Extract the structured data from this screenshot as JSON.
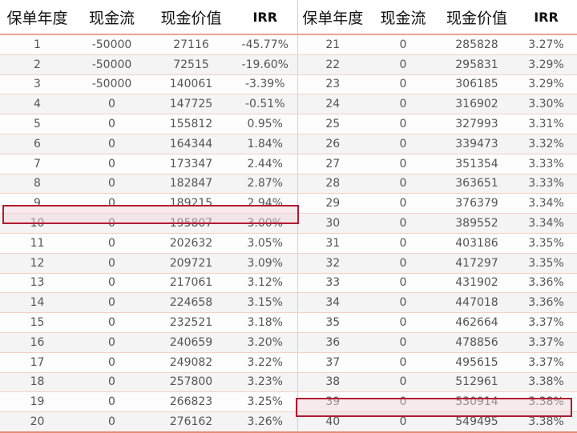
{
  "headers": [
    "保单年度",
    "现金流",
    "现金价值",
    "IRR",
    "保单年度",
    "现金流",
    "现金价值",
    "IRR"
  ],
  "rows": [
    [
      "1",
      "-50000",
      "27116",
      "-45.77%",
      "21",
      "0",
      "285828",
      "3.27%"
    ],
    [
      "2",
      "-50000",
      "72515",
      "-19.60%",
      "22",
      "0",
      "295831",
      "3.29%"
    ],
    [
      "3",
      "-50000",
      "140061",
      "-3.39%",
      "23",
      "0",
      "306185",
      "3.29%"
    ],
    [
      "4",
      "0",
      "147725",
      "-0.51%",
      "24",
      "0",
      "316902",
      "3.30%"
    ],
    [
      "5",
      "0",
      "155812",
      "0.95%",
      "25",
      "0",
      "327993",
      "3.31%"
    ],
    [
      "6",
      "0",
      "164344",
      "1.84%",
      "26",
      "0",
      "339473",
      "3.32%"
    ],
    [
      "7",
      "0",
      "173347",
      "2.44%",
      "27",
      "0",
      "351354",
      "3.33%"
    ],
    [
      "8",
      "0",
      "182847",
      "2.87%",
      "28",
      "0",
      "363651",
      "3.33%"
    ],
    [
      "9",
      "0",
      "189215",
      "2.94%",
      "29",
      "0",
      "376379",
      "3.34%"
    ],
    [
      "10",
      "0",
      "195807",
      "3.00%",
      "30",
      "0",
      "389552",
      "3.34%"
    ],
    [
      "11",
      "0",
      "202632",
      "3.05%",
      "31",
      "0",
      "403186",
      "3.35%"
    ],
    [
      "12",
      "0",
      "209721",
      "3.09%",
      "32",
      "0",
      "417297",
      "3.35%"
    ],
    [
      "13",
      "0",
      "217061",
      "3.12%",
      "33",
      "0",
      "431902",
      "3.36%"
    ],
    [
      "14",
      "0",
      "224658",
      "3.15%",
      "34",
      "0",
      "447018",
      "3.36%"
    ],
    [
      "15",
      "0",
      "232521",
      "3.18%",
      "35",
      "0",
      "462664",
      "3.37%"
    ],
    [
      "16",
      "0",
      "240659",
      "3.20%",
      "36",
      "0",
      "478856",
      "3.37%"
    ],
    [
      "17",
      "0",
      "249082",
      "3.22%",
      "37",
      "0",
      "495615",
      "3.37%"
    ],
    [
      "18",
      "0",
      "257800",
      "3.23%",
      "38",
      "0",
      "512961",
      "3.38%"
    ],
    [
      "19",
      "0",
      "266823",
      "3.25%",
      "39",
      "0",
      "530914",
      "3.38%"
    ],
    [
      "20",
      "0",
      "276162",
      "3.26%",
      "40",
      "0",
      "549495",
      "3.38%"
    ]
  ],
  "highlight_color": "#b01c2e",
  "rule_color": "#e38b73"
}
